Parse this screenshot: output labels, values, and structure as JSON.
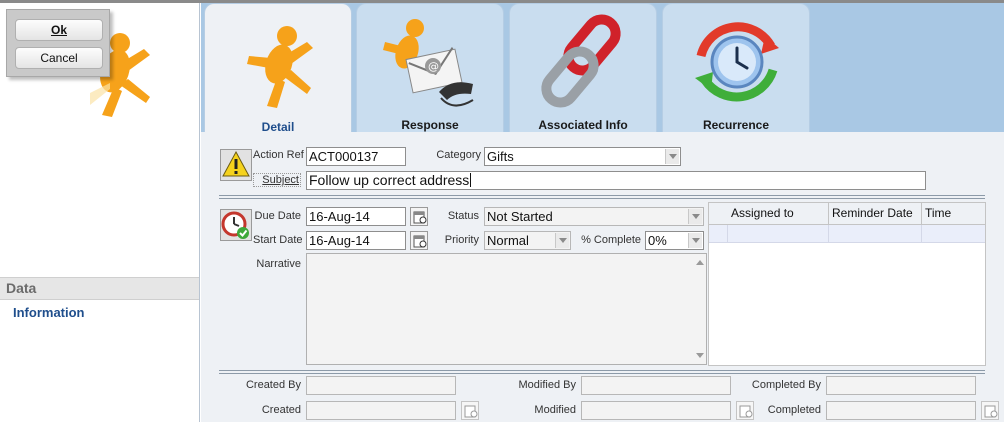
{
  "dialog": {
    "ok_label": "Ok",
    "cancel_label": "Cancel"
  },
  "sidebar": {
    "section_title": "Data",
    "items": [
      {
        "label": "Information"
      }
    ]
  },
  "tabs": [
    {
      "label": "Detail",
      "icon": "runner-icon",
      "active": true
    },
    {
      "label": "Response",
      "icon": "envelope-phone-icon",
      "active": false
    },
    {
      "label": "Associated Info",
      "icon": "chain-link-icon",
      "active": false
    },
    {
      "label": "Recurrence",
      "icon": "recurrence-clock-icon",
      "active": false
    }
  ],
  "form": {
    "action_ref": {
      "label": "Action Ref",
      "value": "ACT000137"
    },
    "category": {
      "label": "Category",
      "value": "Gifts"
    },
    "subject": {
      "label": "Subject",
      "value": "Follow up correct address"
    },
    "due_date": {
      "label": "Due Date",
      "value": "16-Aug-14"
    },
    "start_date": {
      "label": "Start Date",
      "value": "16-Aug-14"
    },
    "status": {
      "label": "Status",
      "value": "Not Started"
    },
    "priority": {
      "label": "Priority",
      "value": "Normal"
    },
    "percent_complete": {
      "label": "% Complete",
      "value": "0%"
    },
    "narrative": {
      "label": "Narrative",
      "value": ""
    }
  },
  "assignments": {
    "columns": [
      "Assigned to",
      "Reminder Date",
      "Time"
    ],
    "rows": [
      [
        "",
        "",
        ""
      ]
    ]
  },
  "audit": {
    "created_by": {
      "label": "Created By",
      "value": ""
    },
    "created": {
      "label": "Created",
      "value": ""
    },
    "modified_by": {
      "label": "Modified By",
      "value": ""
    },
    "modified": {
      "label": "Modified",
      "value": ""
    },
    "completed_by": {
      "label": "Completed By",
      "value": ""
    },
    "completed": {
      "label": "Completed",
      "value": ""
    }
  },
  "colors": {
    "accent": "#1f4e8c",
    "panel": "#a9c8e4",
    "tab": "#c9ddef",
    "form_bg": "#eef1f5"
  }
}
